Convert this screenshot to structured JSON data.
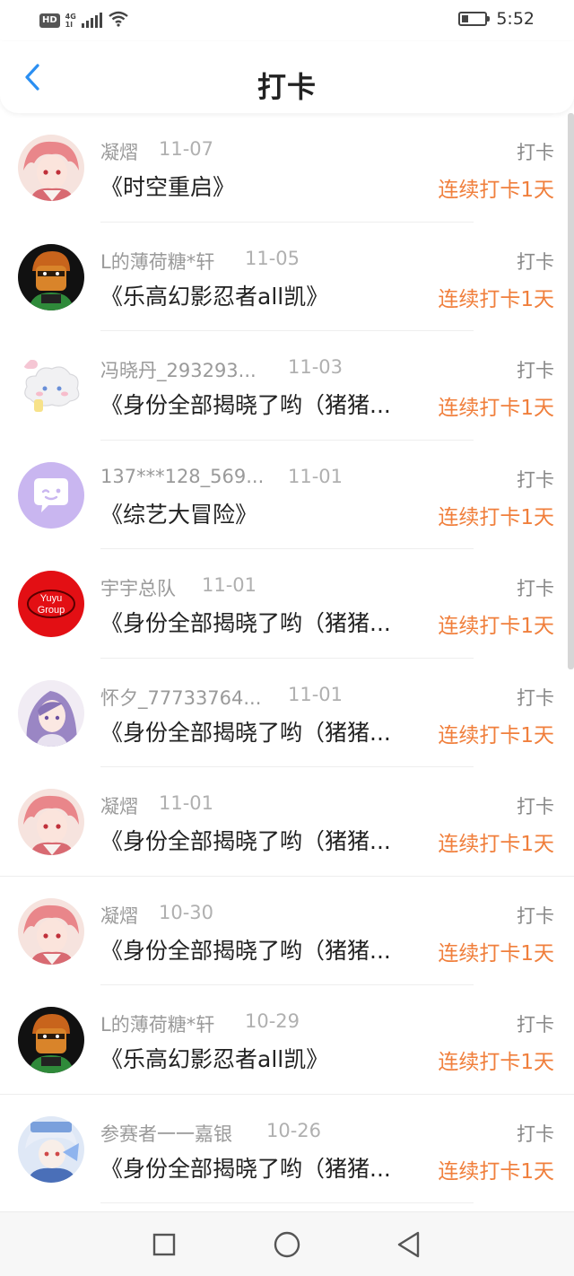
{
  "status_bar": {
    "hd_label": "HD",
    "net_label": "4G",
    "net_sub": "1l",
    "time": "5:52",
    "icons": [
      "hd-icon",
      "signal-icon",
      "wifi-icon",
      "battery-icon"
    ]
  },
  "header": {
    "title": "打卡",
    "back_icon": "chevron-left-icon",
    "accent_color": "#2b8ff2"
  },
  "theme": {
    "streak_color": "#f07f3c",
    "username_color": "#9a9a9a",
    "title_color": "#222222"
  },
  "list": {
    "items": [
      {
        "user": "凝熠",
        "date": "11-07",
        "tag": "打卡",
        "title": "《时空重启》",
        "streak": "连续打卡1天",
        "avatar": "anime-boy-avatar"
      },
      {
        "user": "L的薄荷糖*轩",
        "date": "11-05",
        "tag": "打卡",
        "title": "《乐高幻影忍者all凯》",
        "streak": "连续打卡1天",
        "avatar": "lego-figure-avatar"
      },
      {
        "user": "冯晓丹_293293...",
        "date": "11-03",
        "tag": "打卡",
        "title": "《身份全部揭晓了哟（猪猪...",
        "streak": "连续打卡1天",
        "avatar": "cloud-cartoon-avatar"
      },
      {
        "user": "137***128_569...",
        "date": "11-01",
        "tag": "打卡",
        "title": "《综艺大冒险》",
        "streak": "连续打卡1天",
        "avatar": "chat-bubble-avatar"
      },
      {
        "user": "宇宇总队",
        "date": "11-01",
        "tag": "打卡",
        "title": "《身份全部揭晓了哟（猪猪...",
        "streak": "连续打卡1天",
        "avatar": "yuyu-group-avatar",
        "avatar_text": [
          "Yuyu",
          "Group"
        ]
      },
      {
        "user": "怀夕_77733764...",
        "date": "11-01",
        "tag": "打卡",
        "title": "《身份全部揭晓了哟（猪猪...",
        "streak": "连续打卡1天",
        "avatar": "anime-girl-avatar"
      },
      {
        "user": "凝熠",
        "date": "11-01",
        "tag": "打卡",
        "title": "《身份全部揭晓了哟（猪猪...",
        "streak": "连续打卡1天",
        "avatar": "anime-boy-avatar"
      },
      {
        "user": "凝熠",
        "date": "10-30",
        "tag": "打卡",
        "title": "《身份全部揭晓了哟（猪猪...",
        "streak": "连续打卡1天",
        "avatar": "anime-boy-avatar"
      },
      {
        "user": "L的薄荷糖*轩",
        "date": "10-29",
        "tag": "打卡",
        "title": "《乐高幻影忍者all凯》",
        "streak": "连续打卡1天",
        "avatar": "lego-figure-avatar"
      },
      {
        "user": "参赛者一一嘉银",
        "date": "10-26",
        "tag": "打卡",
        "title": "《身份全部揭晓了哟（猪猪...",
        "streak": "连续打卡1天",
        "avatar": "anime-character-avatar"
      }
    ]
  },
  "system_nav": {
    "buttons": [
      "square-icon",
      "circle-icon",
      "triangle-back-icon"
    ]
  }
}
